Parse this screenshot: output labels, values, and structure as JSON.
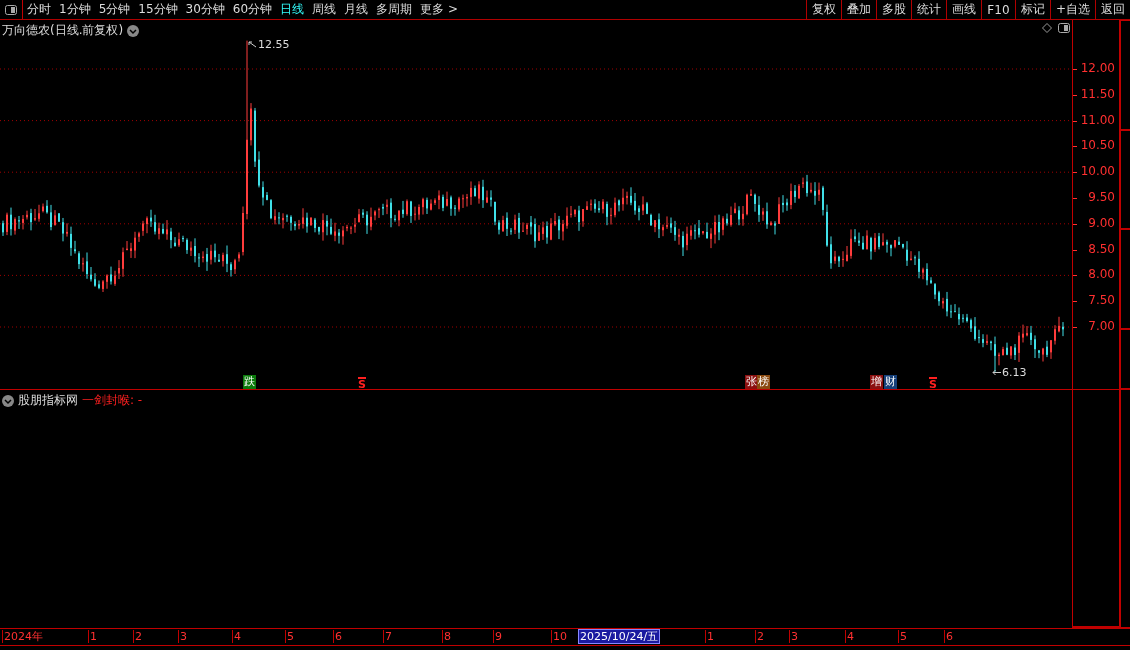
{
  "toolbar": {
    "periods": [
      {
        "label": "分时",
        "selected": false
      },
      {
        "label": "1分钟",
        "selected": false
      },
      {
        "label": "5分钟",
        "selected": false
      },
      {
        "label": "15分钟",
        "selected": false
      },
      {
        "label": "30分钟",
        "selected": false
      },
      {
        "label": "60分钟",
        "selected": false
      },
      {
        "label": "日线",
        "selected": true
      },
      {
        "label": "周线",
        "selected": false
      },
      {
        "label": "月线",
        "selected": false
      },
      {
        "label": "多周期",
        "selected": false
      },
      {
        "label": "更多 >",
        "selected": false
      }
    ],
    "actions": [
      "复权",
      "叠加",
      "多股",
      "统计",
      "画线",
      "F10",
      "标记",
      "+自选",
      "返回"
    ]
  },
  "chart": {
    "title": "万向德农(日线.前复权)",
    "high_label": "12.55",
    "low_label": "6.13",
    "price_ticks": [
      "12.00",
      "11.50",
      "11.00",
      "10.50",
      "10.00",
      "9.50",
      "9.00",
      "8.50",
      "8.00",
      "7.50",
      "7.00"
    ],
    "markers": [
      {
        "kind": "tag",
        "text": "跌",
        "color": "#0b7a0b"
      },
      {
        "kind": "signal",
        "text": "S",
        "color": "#ff2020"
      },
      {
        "kind": "tag",
        "text": "张",
        "color": "#8b1010"
      },
      {
        "kind": "tag",
        "text": "榜",
        "color": "#8b4a10"
      },
      {
        "kind": "tag",
        "text": "增",
        "color": "#8b1010"
      },
      {
        "kind": "tag",
        "text": "财",
        "color": "#16407a"
      },
      {
        "kind": "signal",
        "text": "S",
        "color": "#ff2020"
      }
    ]
  },
  "indicator": {
    "name": "股朋指标网",
    "formula": "一剑封喉: -"
  },
  "time_axis": {
    "labels": [
      "2024年",
      "1",
      "2",
      "3",
      "4",
      "5",
      "6",
      "7",
      "8",
      "9",
      "10",
      "1",
      "2",
      "3",
      "4",
      "5",
      "6"
    ],
    "cursor_date": "2025/10/24/五"
  }
}
